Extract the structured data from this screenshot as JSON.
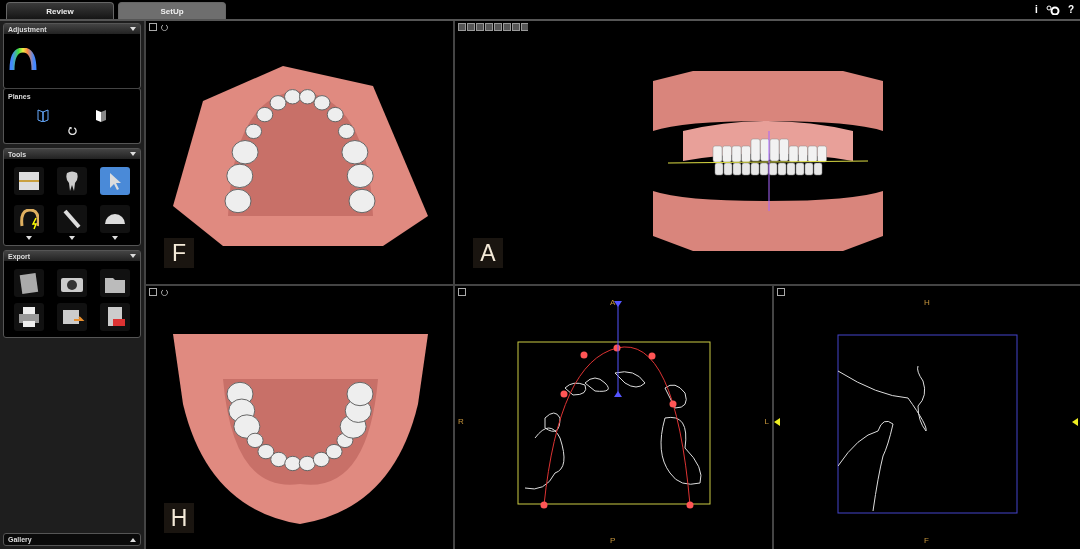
{
  "tabs": [
    {
      "label": "Review",
      "selected": true
    },
    {
      "label": "SetUp",
      "selected": false
    }
  ],
  "top_icons": {
    "info": "i",
    "help": "?"
  },
  "sidebar": {
    "panels": [
      {
        "title": "Adjustment",
        "kind": "adjustment"
      },
      {
        "title": "Planes",
        "kind": "planes"
      },
      {
        "title": "Tools",
        "kind": "tools",
        "tools": [
          {
            "selected": false,
            "menu": false
          },
          {
            "selected": false,
            "menu": false
          },
          {
            "selected": true,
            "menu": false
          },
          {
            "selected": false,
            "menu": true
          },
          {
            "selected": false,
            "menu": true
          },
          {
            "selected": false,
            "menu": true
          }
        ]
      },
      {
        "title": "Export",
        "kind": "export"
      }
    ],
    "gallery": {
      "title": "Gallery"
    }
  },
  "views": [
    {
      "kind": "upper-arch",
      "label": "F"
    },
    {
      "kind": "frontal",
      "label": "A"
    },
    {
      "kind": "lower-arch",
      "label": "H"
    },
    {
      "kind": "axial-trace",
      "top": "A",
      "bottom": "P",
      "left": "R",
      "right": "L"
    },
    {
      "kind": "sagittal-trace",
      "top": "H",
      "bottom": "F"
    }
  ]
}
